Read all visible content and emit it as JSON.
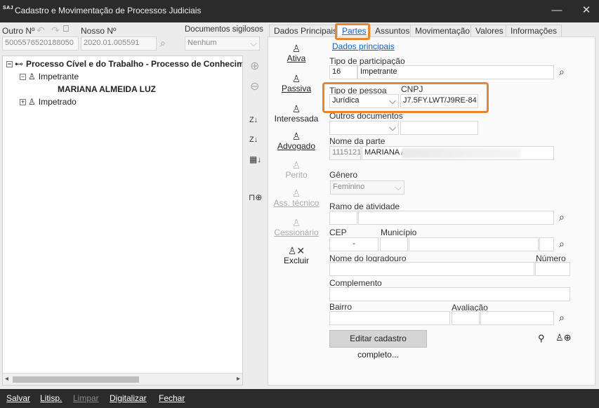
{
  "titlebar": {
    "logo": "SAJ",
    "title": "Cadastro e Movimentação de Processos Judiciais",
    "minimize_glyph": "—",
    "close_glyph": "✕"
  },
  "top": {
    "outro_label": "Outro Nº",
    "outro_value": "5005576520188050",
    "nosso_label": "Nosso Nº",
    "nosso_value": "2020.01.005591",
    "sigilosos_label": "Documentos sigilosos",
    "sigilosos_value": "Nenhum"
  },
  "tree": {
    "root": "Processo Cível e do Trabalho - Processo de Conhecimento",
    "impetrante": "Impetrante",
    "impetrante_child": "MARIANA ALMEIDA LUZ",
    "impetrado": "Impetrado"
  },
  "tabs": [
    {
      "label": "Dados Principais"
    },
    {
      "label": "Partes"
    },
    {
      "label": "Assuntos"
    },
    {
      "label": "Movimentação"
    },
    {
      "label": "Valores"
    },
    {
      "label": "Informações"
    }
  ],
  "roles": {
    "ativa": "Ativa",
    "passiva": "Passiva",
    "interessada": "Interessada",
    "advogado": "Advogado",
    "perito": "Perito",
    "ass_tecnico": "Ass. técnico",
    "cessionario": "Cessionário",
    "excluir": "Excluir"
  },
  "form": {
    "section_link": "Dados principais",
    "tipo_participacao_label": "Tipo de participação",
    "tipo_participacao_code": "16",
    "tipo_participacao_value": "Impetrante",
    "tipo_pessoa_label": "Tipo de pessoa",
    "tipo_pessoa_value": "Jurídica",
    "cnpj_label": "CNPJ",
    "cnpj_value": "J7.5FY.LWT/J9RE-84",
    "outros_docs_label": "Outros documentos",
    "nome_parte_label": "Nome da parte",
    "nome_parte_code": "1115121",
    "nome_parte_value": "MARIANA A",
    "genero_label": "Gênero",
    "genero_value": "Feminino",
    "ramo_label": "Ramo de atividade",
    "cep_label": "CEP",
    "cep_value": "-",
    "municipio_label": "Município",
    "logradouro_label": "Nome do logradouro",
    "numero_label": "Número",
    "complemento_label": "Complemento",
    "bairro_label": "Bairro",
    "avaliacao_label": "Avaliação",
    "edit_button": "Editar cadastro completo..."
  },
  "bottom": {
    "salvar": "Salvar",
    "litisp": "Litisp.",
    "limpar": "Limpar",
    "digitalizar": "Digitalizar",
    "fechar": "Fechar"
  },
  "colors": {
    "highlight": "#e8852d",
    "link": "#1a5fb4",
    "titlebar": "#2b2b2b"
  }
}
